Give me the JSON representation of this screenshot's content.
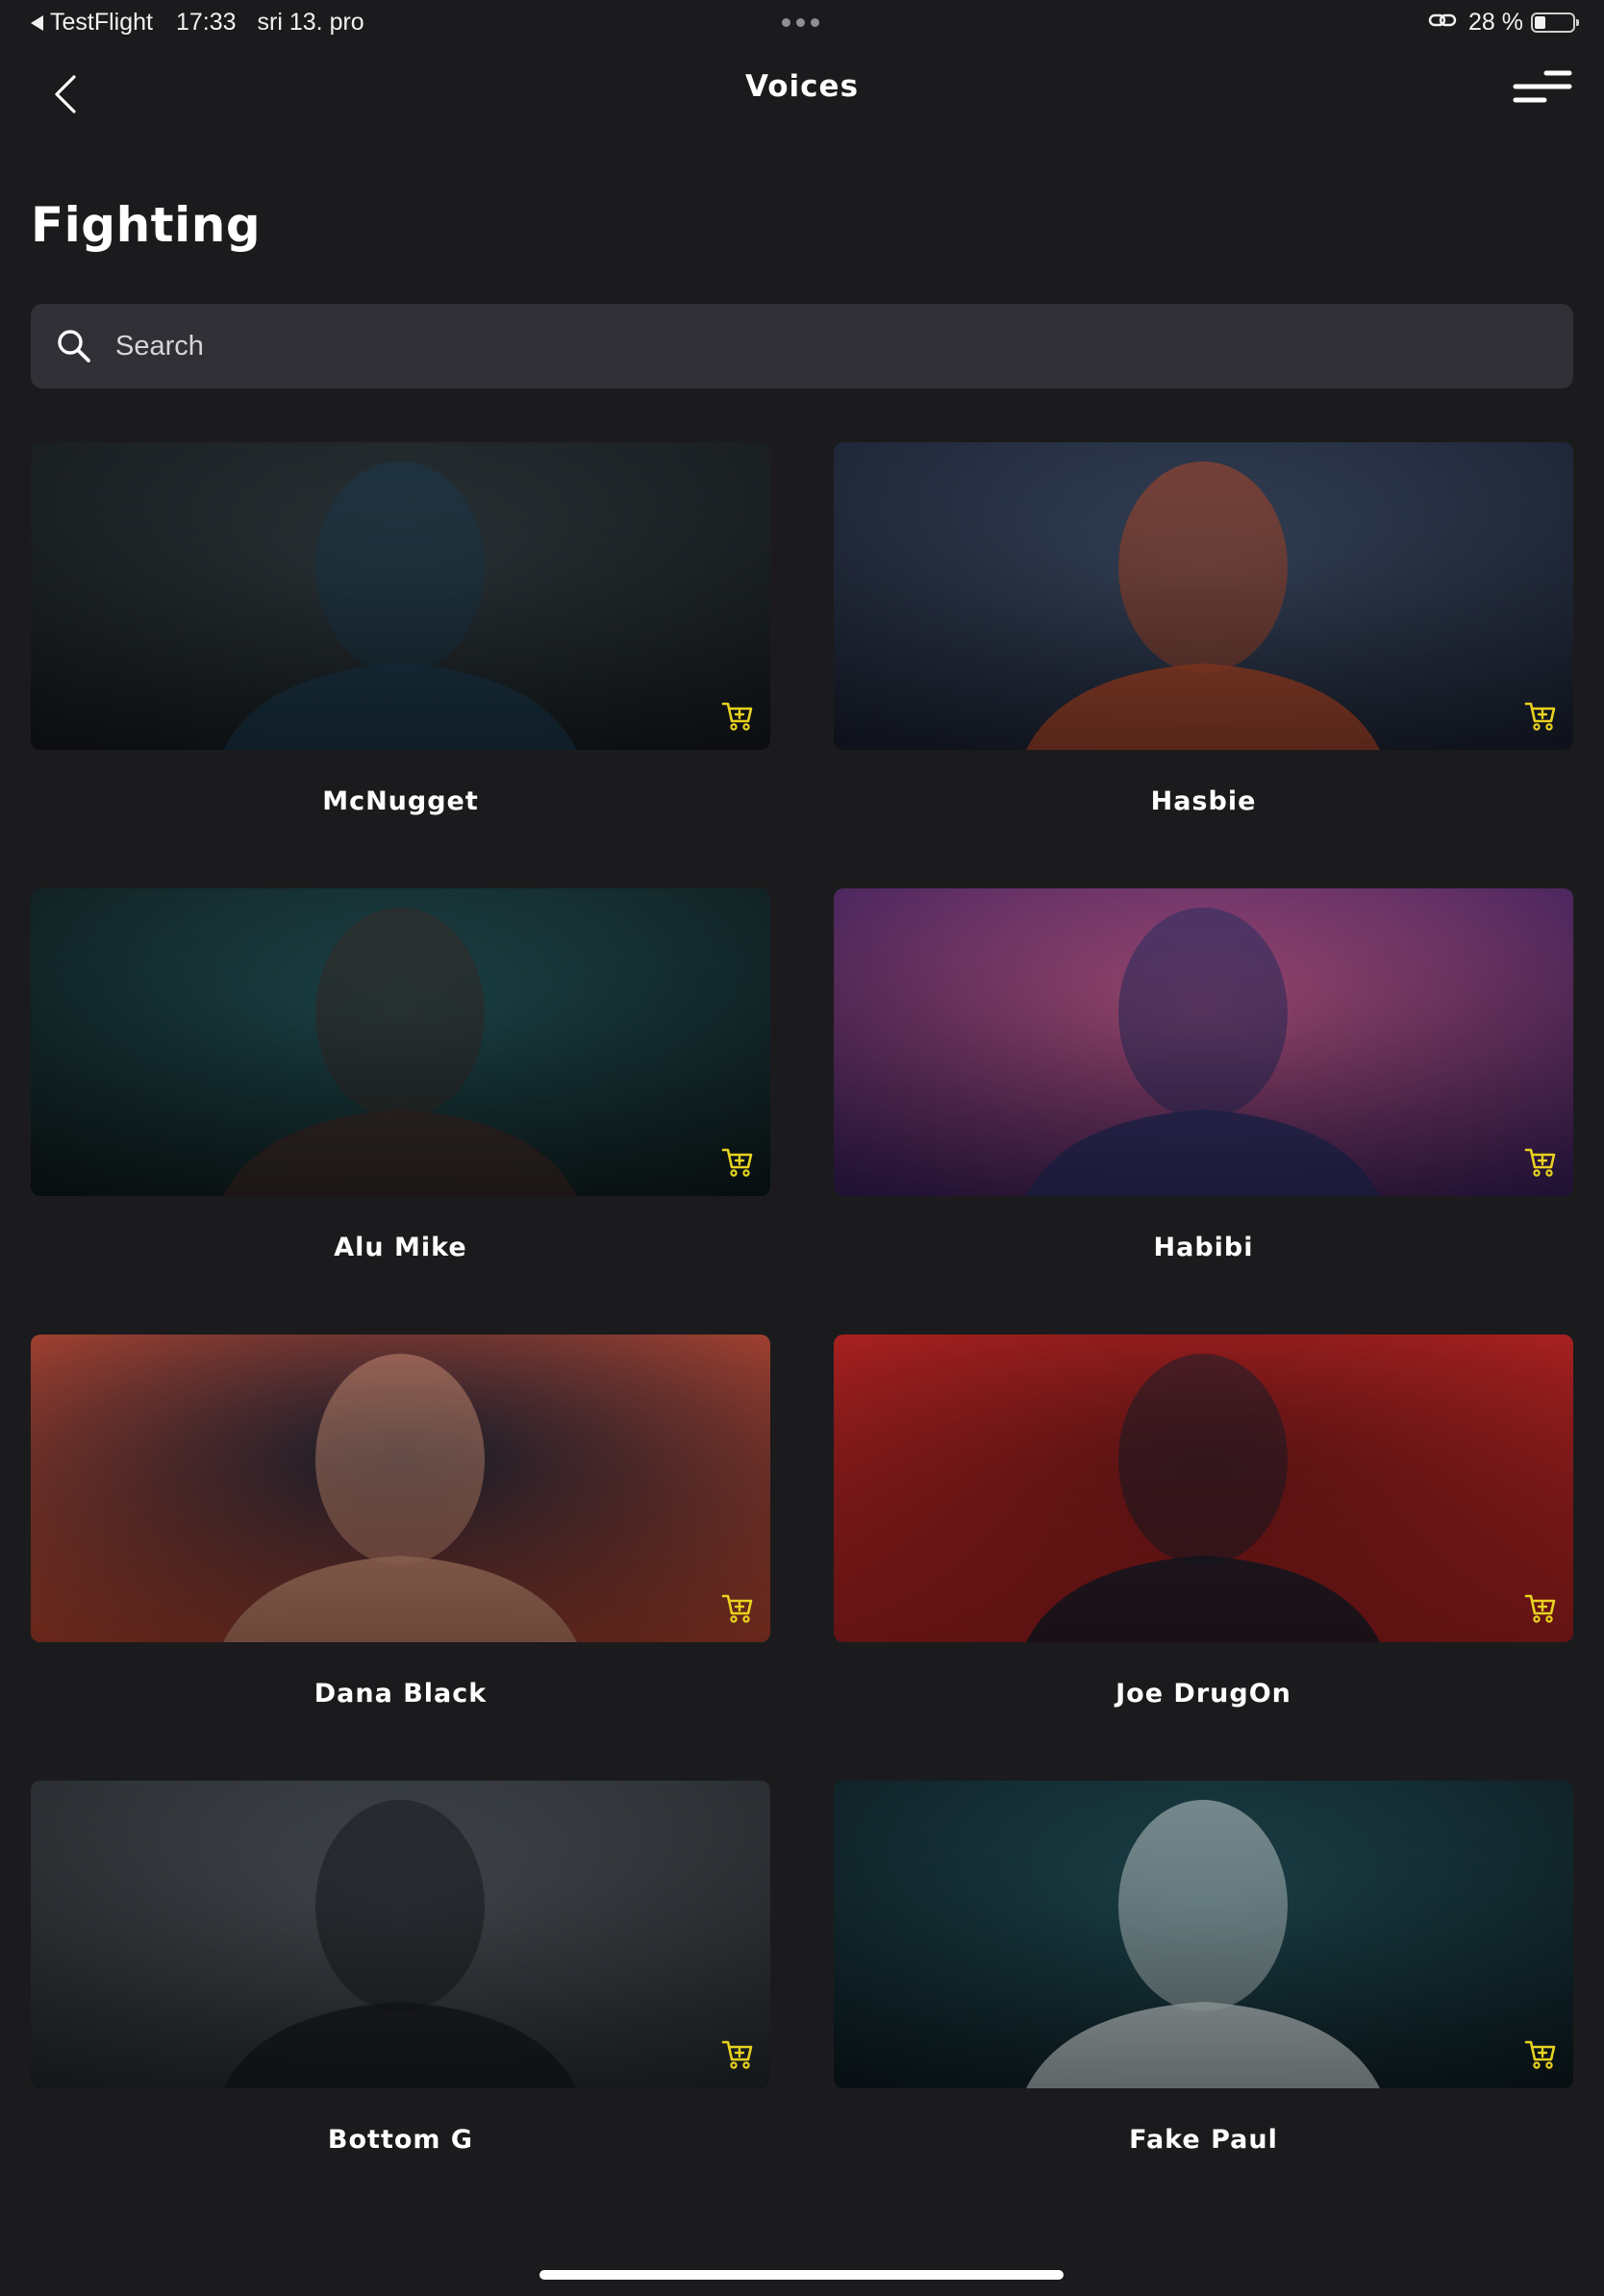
{
  "status_bar": {
    "back_app": "TestFlight",
    "time": "17:33",
    "date": "sri 13. pro",
    "battery_text": "28 %",
    "battery_level": 0.28
  },
  "nav": {
    "title": "Voices",
    "back_icon": "chevron-left-icon",
    "menu_icon": "menu-icon"
  },
  "section": {
    "title": "Fighting"
  },
  "search": {
    "placeholder": "Search",
    "value": ""
  },
  "colors": {
    "background": "#1b1b1d",
    "search_bg": "#303036",
    "cart_accent": "#e8d21f"
  },
  "voices": [
    {
      "name": "McNugget",
      "icon": "cart-icon",
      "palette": [
        "#2f3a3e",
        "#15191c",
        "#1c3a4e"
      ]
    },
    {
      "name": "Hasbie",
      "icon": "cart-icon",
      "palette": [
        "#3b4a63",
        "#1a2030",
        "#b44a2a"
      ]
    },
    {
      "name": "Alu Mike",
      "icon": "cart-icon",
      "palette": [
        "#1f4d52",
        "#0f1a1c",
        "#3a2c28"
      ]
    },
    {
      "name": "Habibi",
      "icon": "cart-icon",
      "palette": [
        "#b2527e",
        "#3a1f5a",
        "#2a2f66"
      ]
    },
    {
      "name": "Dana Black",
      "icon": "cart-icon",
      "palette": [
        "#1a2233",
        "#b8452f",
        "#c98d73"
      ]
    },
    {
      "name": "Joe DrugOn",
      "icon": "cart-icon",
      "palette": [
        "#6a1616",
        "#b32222",
        "#1a1f2c"
      ]
    },
    {
      "name": "Bottom G",
      "icon": "cart-icon",
      "palette": [
        "#4a5056",
        "#25292d",
        "#1a1c20"
      ]
    },
    {
      "name": "Fake Paul",
      "icon": "cart-icon",
      "palette": [
        "#1e4a52",
        "#0e1c22",
        "#c9d3d6"
      ]
    }
  ]
}
